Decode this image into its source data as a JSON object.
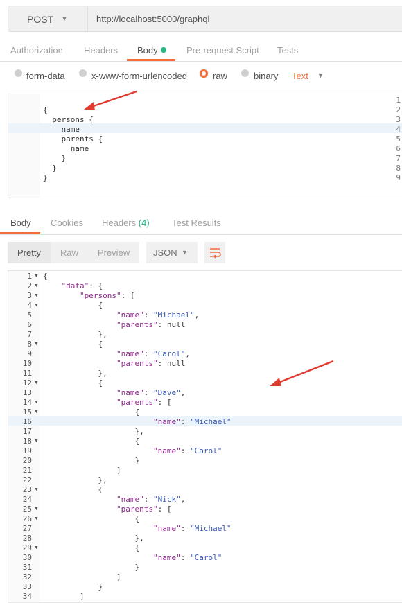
{
  "request": {
    "method": "POST",
    "url": "http://localhost:5000/graphql"
  },
  "request_tabs": [
    "Authorization",
    "Headers",
    "Body",
    "Pre-request Script",
    "Tests"
  ],
  "body_options": [
    "form-data",
    "x-www-form-urlencoded",
    "raw",
    "binary"
  ],
  "body_type": "Text",
  "request_body_lines": [
    "",
    "{",
    "  persons {",
    "    name",
    "    parents {",
    "      name",
    "    }",
    "  }",
    "}"
  ],
  "request_line_numbers": [
    "1",
    "2",
    "3",
    "4",
    "5",
    "6",
    "7",
    "8",
    "9"
  ],
  "response_tabs": {
    "body": "Body",
    "cookies": "Cookies",
    "headers": "Headers",
    "headers_count": "(4)",
    "test_results": "Test Results"
  },
  "response_toolbar": {
    "pretty": "Pretty",
    "raw": "Raw",
    "preview": "Preview",
    "format": "JSON"
  },
  "response_line_numbers": [
    "1",
    "2",
    "3",
    "4",
    "5",
    "6",
    "7",
    "8",
    "9",
    "10",
    "11",
    "12",
    "13",
    "14",
    "15",
    "16",
    "17",
    "18",
    "19",
    "20",
    "21",
    "22",
    "23",
    "24",
    "25",
    "26",
    "27",
    "28",
    "29",
    "30",
    "31",
    "32",
    "33",
    "34"
  ],
  "response_body_lines": [
    "{",
    "    \"data\": {",
    "        \"persons\": [",
    "            {",
    "                \"name\": \"Michael\",",
    "                \"parents\": null",
    "            },",
    "            {",
    "                \"name\": \"Carol\",",
    "                \"parents\": null",
    "            },",
    "            {",
    "                \"name\": \"Dave\",",
    "                \"parents\": [",
    "                    {",
    "                        \"name\": \"Michael\"",
    "                    },",
    "                    {",
    "                        \"name\": \"Carol\"",
    "                    }",
    "                ]",
    "            },",
    "            {",
    "                \"name\": \"Nick\",",
    "                \"parents\": [",
    "                    {",
    "                        \"name\": \"Michael\"",
    "                    },",
    "                    {",
    "                        \"name\": \"Carol\"",
    "                    }",
    "                ]",
    "            }",
    "        ]"
  ],
  "colors": {
    "accent": "#f26b3a",
    "status_dot": "#26b47f",
    "annotation_arrow": "#e03c31",
    "json_key": "#92278f",
    "json_string": "#3b5ab7"
  }
}
